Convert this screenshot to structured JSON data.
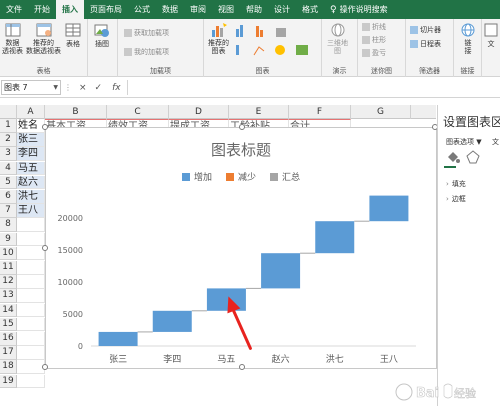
{
  "menu": {
    "tabs": [
      "文件",
      "开始",
      "插入",
      "页面布局",
      "公式",
      "数据",
      "审阅",
      "视图",
      "帮助",
      "设计",
      "格式"
    ],
    "active_index": 2,
    "tell_me": "操作说明搜索"
  },
  "ribbon": {
    "tables": {
      "pivot_label": "数据\n透视表",
      "recommended_label": "推荐的\n数据透视表",
      "table_label": "表格",
      "group": "表格"
    },
    "illustrations": {
      "label": "插图"
    },
    "addins": {
      "get_label": "获取加载项",
      "my_label": "我的加载项",
      "group": "加载项"
    },
    "charts": {
      "recommended_label": "推荐的\n图表",
      "group": "图表"
    },
    "map3d": {
      "label": "三维地\n图",
      "group": "演示"
    },
    "sparklines": {
      "line": "折线",
      "column": "柱形",
      "winloss": "盈亏",
      "group": "迷你图"
    },
    "filters": {
      "slicer": "切片器",
      "timeline": "日程表",
      "group": "筛选器"
    },
    "links": {
      "label": "链\n接",
      "group": "链接"
    },
    "text": {
      "label": "文"
    }
  },
  "formula_bar": {
    "name_box": "图表 7",
    "cancel": "×",
    "enter": "✓",
    "fx": "fx",
    "formula": ""
  },
  "grid": {
    "columns": [
      "A",
      "B",
      "C",
      "D",
      "E",
      "F",
      "G"
    ],
    "rows": [
      "1",
      "2",
      "3",
      "4",
      "5",
      "6",
      "7",
      "8",
      "9",
      "10",
      "11",
      "12",
      "13",
      "14",
      "15",
      "16",
      "17",
      "18",
      "19"
    ],
    "col_a_values": [
      "姓名",
      "张三",
      "李四",
      "马五",
      "赵六",
      "洪七",
      "王八"
    ],
    "header_row": [
      "基本工资",
      "绩效工资",
      "提成工资",
      "工龄补贴",
      "合计"
    ]
  },
  "chart": {
    "title": "图表标题",
    "legend": [
      {
        "name": "增加",
        "color": "#5b9bd5"
      },
      {
        "name": "减少",
        "color": "#ed7d31"
      },
      {
        "name": "汇总",
        "color": "#a5a5a5"
      }
    ]
  },
  "chart_data": {
    "type": "bar",
    "subtype": "waterfall",
    "title": "图表标题",
    "categories": [
      "张三",
      "李四",
      "马五",
      "赵六",
      "洪七",
      "王八"
    ],
    "series": [
      {
        "name": "增加",
        "base": [
          0,
          2200,
          5500,
          9000,
          14500,
          19500
        ],
        "values": [
          2200,
          3300,
          3500,
          5500,
          5000,
          4000
        ]
      },
      {
        "name": "减少",
        "values": [
          0,
          0,
          0,
          0,
          0,
          0
        ]
      },
      {
        "name": "汇总",
        "values": [
          0,
          0,
          0,
          0,
          0,
          0
        ]
      }
    ],
    "yticks": [
      0,
      5000,
      10000,
      15000,
      20000
    ],
    "ylim": [
      0,
      25000
    ],
    "grid": true,
    "legend_position": "top",
    "annotation": "red arrow pointing to the connector between 马五 and 赵六"
  },
  "side_pane": {
    "title": "设置图表区",
    "options_tab": "图表选项",
    "text_tab": "文",
    "rows": [
      "填充",
      "边框"
    ]
  }
}
